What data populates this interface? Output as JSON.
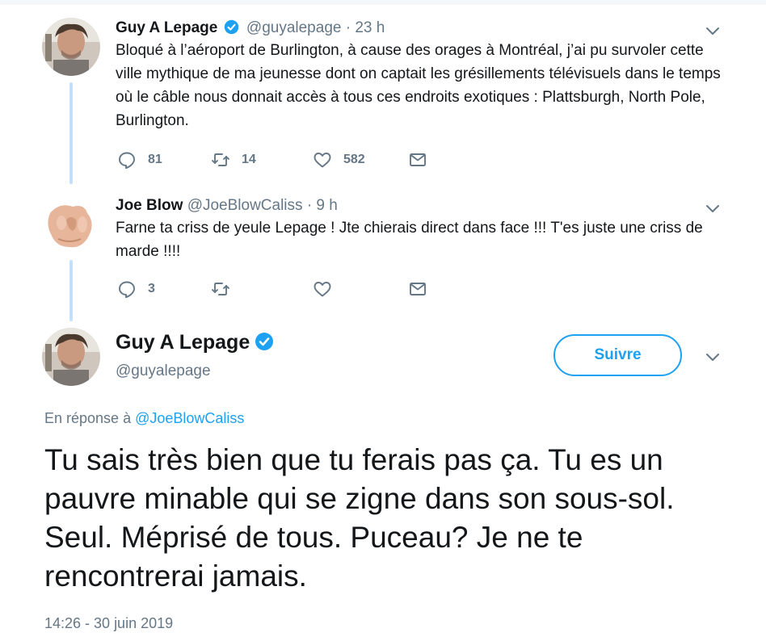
{
  "tweets": [
    {
      "name": "Guy A Lepage",
      "verified": true,
      "handle": "@guyalepage",
      "dot": "·",
      "time": "23 h",
      "text": "Bloqué à l’aéroport de Burlington, à cause des orages à Montréal, j’ai pu survoler cette ville mythique de ma jeunesse dont on captait les grésillements télévisuels dans le temps où le câble nous donnait accès à tous ces endroits exotiques : Plattsburgh, North Pole, Burlington.",
      "reply_count": "81",
      "retweet_count": "14",
      "like_count": "582"
    },
    {
      "name": "Joe Blow",
      "verified": false,
      "handle": "@JoeBlowCaliss",
      "dot": "·",
      "time": "9 h",
      "text": "Farne ta criss de yeule Lepage ! Jte chierais direct dans face !!! T'es juste une criss de marde !!!!",
      "reply_count": "3",
      "retweet_count": "",
      "like_count": ""
    }
  ],
  "main": {
    "name": "Guy A Lepage",
    "handle": "@guyalepage",
    "follow_label": "Suivre",
    "reply_prefix": "En réponse à",
    "reply_mention": "@JoeBlowCaliss",
    "text": "Tu sais très bien que tu ferais pas ça. Tu es un pauvre minable qui se zigne dans son sous-sol. Seul. Méprisé de tous. Puceau? Je ne te rencontrerai jamais.",
    "timestamp": "14:26 - 30 juin 2019"
  },
  "colors": {
    "accent": "#1da1f2",
    "muted": "#657786",
    "thread_line": "#c4dffa"
  }
}
